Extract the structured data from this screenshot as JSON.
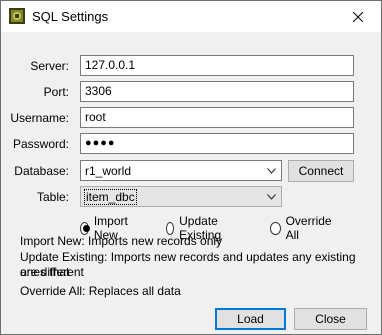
{
  "window": {
    "title": "SQL Settings"
  },
  "fields": {
    "server_label": "Server:",
    "server_value": "127.0.0.1",
    "port_label": "Port:",
    "port_value": "3306",
    "username_label": "Username:",
    "username_value": "root",
    "password_label": "Password:",
    "password_value": "●●●●",
    "database_label": "Database:",
    "database_value": "r1_world",
    "table_label": "Table:",
    "table_value": "item_dbc"
  },
  "buttons": {
    "connect": "Connect",
    "load": "Load",
    "close": "Close"
  },
  "modes": [
    {
      "label": "Import New",
      "checked": true
    },
    {
      "label": "Update Existing",
      "checked": false
    },
    {
      "label": "Override All",
      "checked": false
    }
  ],
  "info": {
    "import_new": "Import New: Imports new records only",
    "update_existing_1": "Update Existing: Imports new records and updates any existing ones that",
    "update_existing_2": "are different",
    "override_all": "Override All: Replaces all data"
  },
  "icons": {
    "app": "dbc-editor-icon",
    "close": "close-icon",
    "dropdown": "chevron-down-icon"
  }
}
